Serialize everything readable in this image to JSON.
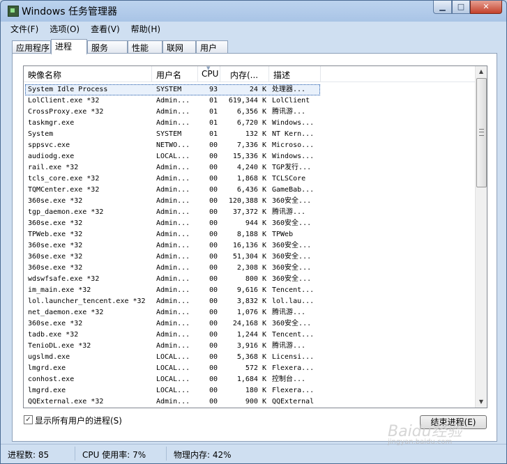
{
  "window": {
    "title": "Windows 任务管理器",
    "buttons": {
      "minimize": "▁",
      "maximize": "□",
      "close": "✕"
    }
  },
  "menu": [
    "文件(F)",
    "选项(O)",
    "查看(V)",
    "帮助(H)"
  ],
  "tabs": [
    {
      "label": "应用程序",
      "active": false
    },
    {
      "label": "进程",
      "active": true
    },
    {
      "label": "服务",
      "active": false
    },
    {
      "label": "性能",
      "active": false
    },
    {
      "label": "联网",
      "active": false
    },
    {
      "label": "用户",
      "active": false
    }
  ],
  "columns": {
    "name": "映像名称",
    "user": "用户名",
    "cpu": "CPU",
    "mem": "内存(...",
    "desc": "描述"
  },
  "processes": [
    {
      "name": "System Idle Process",
      "user": "SYSTEM",
      "cpu": "93",
      "mem": "24 K",
      "desc": "处理器...",
      "selected": true
    },
    {
      "name": "LolClient.exe *32",
      "user": "Admin...",
      "cpu": "01",
      "mem": "619,344 K",
      "desc": "LolClient"
    },
    {
      "name": "CrossProxy.exe *32",
      "user": "Admin...",
      "cpu": "01",
      "mem": "6,356 K",
      "desc": "腾讯游..."
    },
    {
      "name": "taskmgr.exe",
      "user": "Admin...",
      "cpu": "01",
      "mem": "6,720 K",
      "desc": "Windows..."
    },
    {
      "name": "System",
      "user": "SYSTEM",
      "cpu": "01",
      "mem": "132 K",
      "desc": "NT Kern..."
    },
    {
      "name": "sppsvc.exe",
      "user": "NETWO...",
      "cpu": "00",
      "mem": "7,336 K",
      "desc": "Microso..."
    },
    {
      "name": "audiodg.exe",
      "user": "LOCAL...",
      "cpu": "00",
      "mem": "15,336 K",
      "desc": "Windows..."
    },
    {
      "name": "rail.exe *32",
      "user": "Admin...",
      "cpu": "00",
      "mem": "4,240 K",
      "desc": "TGP发行..."
    },
    {
      "name": "tcls_core.exe *32",
      "user": "Admin...",
      "cpu": "00",
      "mem": "1,868 K",
      "desc": "TCLSCore"
    },
    {
      "name": "TQMCenter.exe *32",
      "user": "Admin...",
      "cpu": "00",
      "mem": "6,436 K",
      "desc": "GameBab..."
    },
    {
      "name": "360se.exe *32",
      "user": "Admin...",
      "cpu": "00",
      "mem": "120,388 K",
      "desc": "360安全..."
    },
    {
      "name": "tgp_daemon.exe *32",
      "user": "Admin...",
      "cpu": "00",
      "mem": "37,372 K",
      "desc": "腾讯游..."
    },
    {
      "name": "360se.exe *32",
      "user": "Admin...",
      "cpu": "00",
      "mem": "944 K",
      "desc": "360安全..."
    },
    {
      "name": "TPWeb.exe *32",
      "user": "Admin...",
      "cpu": "00",
      "mem": "8,188 K",
      "desc": "TPWeb"
    },
    {
      "name": "360se.exe *32",
      "user": "Admin...",
      "cpu": "00",
      "mem": "16,136 K",
      "desc": "360安全..."
    },
    {
      "name": "360se.exe *32",
      "user": "Admin...",
      "cpu": "00",
      "mem": "51,304 K",
      "desc": "360安全..."
    },
    {
      "name": "360se.exe *32",
      "user": "Admin...",
      "cpu": "00",
      "mem": "2,308 K",
      "desc": "360安全..."
    },
    {
      "name": "wdswfsafe.exe *32",
      "user": "Admin...",
      "cpu": "00",
      "mem": "800 K",
      "desc": "360安全..."
    },
    {
      "name": "im_main.exe *32",
      "user": "Admin...",
      "cpu": "00",
      "mem": "9,616 K",
      "desc": "Tencent..."
    },
    {
      "name": "lol.launcher_tencent.exe *32",
      "user": "Admin...",
      "cpu": "00",
      "mem": "3,832 K",
      "desc": "lol.lau..."
    },
    {
      "name": "net_daemon.exe *32",
      "user": "Admin...",
      "cpu": "00",
      "mem": "1,076 K",
      "desc": "腾讯游..."
    },
    {
      "name": "360se.exe *32",
      "user": "Admin...",
      "cpu": "00",
      "mem": "24,168 K",
      "desc": "360安全..."
    },
    {
      "name": "tadb.exe *32",
      "user": "Admin...",
      "cpu": "00",
      "mem": "1,244 K",
      "desc": "Tencent..."
    },
    {
      "name": "TenioDL.exe *32",
      "user": "Admin...",
      "cpu": "00",
      "mem": "3,916 K",
      "desc": "腾讯游..."
    },
    {
      "name": "ugslmd.exe",
      "user": "LOCAL...",
      "cpu": "00",
      "mem": "5,368 K",
      "desc": "Licensi..."
    },
    {
      "name": "lmgrd.exe",
      "user": "LOCAL...",
      "cpu": "00",
      "mem": "572 K",
      "desc": "Flexera..."
    },
    {
      "name": "conhost.exe",
      "user": "LOCAL...",
      "cpu": "00",
      "mem": "1,684 K",
      "desc": "控制台..."
    },
    {
      "name": "lmgrd.exe",
      "user": "LOCAL...",
      "cpu": "00",
      "mem": "180 K",
      "desc": "Flexera..."
    },
    {
      "name": "QQExternal.exe *32",
      "user": "Admin...",
      "cpu": "00",
      "mem": "900 K",
      "desc": "QQExternal"
    }
  ],
  "show_all": {
    "label": "显示所有用户的进程(S)",
    "checked": true
  },
  "end_process_label": "结束进程(E)",
  "status": {
    "processes": "进程数: 85",
    "cpu": "CPU 使用率: 7%",
    "memory": "物理内存: 42%"
  },
  "watermark": {
    "main": "Baidu经验",
    "sub": "jingyan.baidu.com"
  }
}
